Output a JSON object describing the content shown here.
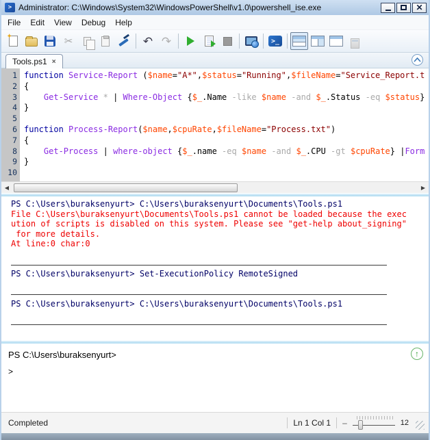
{
  "window": {
    "title": "Administrator: C:\\Windows\\System32\\WindowsPowerShell\\v1.0\\powershell_ise.exe",
    "controls": {
      "minimize": "_",
      "maximize": "□",
      "close": "X"
    }
  },
  "menu": {
    "items": [
      "File",
      "Edit",
      "View",
      "Debug",
      "Help"
    ]
  },
  "toolbar": {
    "icons": [
      "new-script",
      "open-script",
      "save",
      "cut",
      "copy",
      "paste",
      "clear-output-pane",
      "undo",
      "redo",
      "run-script",
      "run-selection",
      "stop-execution",
      "new-remote-powershell-tab",
      "start-powershell-exe",
      "show-script-pane-top",
      "show-script-pane-right",
      "show-script-pane-maximized",
      "script-pane-toggle"
    ]
  },
  "editor": {
    "tab_label": "Tools.ps1",
    "tab_close": "×",
    "line_count": 10,
    "lines": [
      [
        [
          "k",
          "function"
        ],
        [
          "p",
          " "
        ],
        [
          "c",
          "Service-Report"
        ],
        [
          "p",
          " ("
        ],
        [
          "v",
          "$name"
        ],
        [
          "p",
          "="
        ],
        [
          "s",
          "\"A*\""
        ],
        [
          "p",
          ","
        ],
        [
          "v",
          "$status"
        ],
        [
          "p",
          "="
        ],
        [
          "s",
          "\"Running\""
        ],
        [
          "p",
          ","
        ],
        [
          "v",
          "$fileName"
        ],
        [
          "p",
          "="
        ],
        [
          "s",
          "\"Service_Report.t"
        ]
      ],
      [
        [
          "p",
          "{"
        ]
      ],
      [
        [
          "p",
          "    "
        ],
        [
          "c",
          "Get-Service"
        ],
        [
          "p",
          " "
        ],
        [
          "o",
          "*"
        ],
        [
          "p",
          " | "
        ],
        [
          "c",
          "Where-Object"
        ],
        [
          "p",
          " {"
        ],
        [
          "v",
          "$_"
        ],
        [
          "p",
          ".Name "
        ],
        [
          "o",
          "-like"
        ],
        [
          "p",
          " "
        ],
        [
          "v",
          "$name"
        ],
        [
          "p",
          " "
        ],
        [
          "o",
          "-and"
        ],
        [
          "p",
          " "
        ],
        [
          "v",
          "$_"
        ],
        [
          "p",
          ".Status "
        ],
        [
          "o",
          "-eq"
        ],
        [
          "p",
          " "
        ],
        [
          "v",
          "$status"
        ],
        [
          "p",
          "}"
        ]
      ],
      [
        [
          "p",
          "}"
        ]
      ],
      [],
      [
        [
          "k",
          "function"
        ],
        [
          "p",
          " "
        ],
        [
          "c",
          "Process-Report"
        ],
        [
          "p",
          "("
        ],
        [
          "v",
          "$name"
        ],
        [
          "p",
          ","
        ],
        [
          "v",
          "$cpuRate"
        ],
        [
          "p",
          ","
        ],
        [
          "v",
          "$fileName"
        ],
        [
          "p",
          "="
        ],
        [
          "s",
          "\"Process.txt\""
        ],
        [
          "p",
          ")"
        ]
      ],
      [
        [
          "p",
          "{"
        ]
      ],
      [
        [
          "p",
          "    "
        ],
        [
          "c",
          "Get-Process"
        ],
        [
          "p",
          " | "
        ],
        [
          "c",
          "where-object"
        ],
        [
          "p",
          " {"
        ],
        [
          "v",
          "$_"
        ],
        [
          "p",
          ".name "
        ],
        [
          "o",
          "-eq"
        ],
        [
          "p",
          " "
        ],
        [
          "v",
          "$name"
        ],
        [
          "p",
          " "
        ],
        [
          "o",
          "-and"
        ],
        [
          "p",
          " "
        ],
        [
          "v",
          "$_"
        ],
        [
          "p",
          ".CPU "
        ],
        [
          "o",
          "-gt"
        ],
        [
          "p",
          " "
        ],
        [
          "v",
          "$cpuRate"
        ],
        [
          "p",
          "} |"
        ],
        [
          "c",
          "Form"
        ]
      ],
      [
        [
          "p",
          "}"
        ]
      ],
      []
    ],
    "syntax_colors": {
      "keyword": "#0000A0",
      "command": "#8A2BE2",
      "variable": "#FF4500",
      "string": "#8B0000",
      "operator": "#A9A9A9",
      "plain": "#000000"
    }
  },
  "output": {
    "text_color": "#000066",
    "error_color": "#EE0000",
    "lines": [
      {
        "type": "prompt",
        "text": "PS C:\\Users\\buraksenyurt> C:\\Users\\buraksenyurt\\Documents\\Tools.ps1"
      },
      {
        "type": "error",
        "text": "File C:\\Users\\buraksenyurt\\Documents\\Tools.ps1 cannot be loaded because the exec"
      },
      {
        "type": "error",
        "text": "ution of scripts is disabled on this system. Please see \"get-help about_signing\""
      },
      {
        "type": "error",
        "text": " for more details."
      },
      {
        "type": "error",
        "text": "At line:0 char:0"
      },
      {
        "type": "blank"
      },
      {
        "type": "hr"
      },
      {
        "type": "prompt",
        "text": "PS C:\\Users\\buraksenyurt> Set-ExecutionPolicy RemoteSigned"
      },
      {
        "type": "blank"
      },
      {
        "type": "hr"
      },
      {
        "type": "prompt",
        "text": "PS C:\\Users\\buraksenyurt> C:\\Users\\buraksenyurt\\Documents\\Tools.ps1"
      },
      {
        "type": "blank"
      },
      {
        "type": "hr"
      }
    ]
  },
  "command": {
    "prompt": "PS C:\\Users\\buraksenyurt>",
    "input_prompt": ">"
  },
  "status": {
    "state": "Completed",
    "position": "Ln 1 Col 1",
    "zoom_minus": "–",
    "zoom_value": "12"
  }
}
